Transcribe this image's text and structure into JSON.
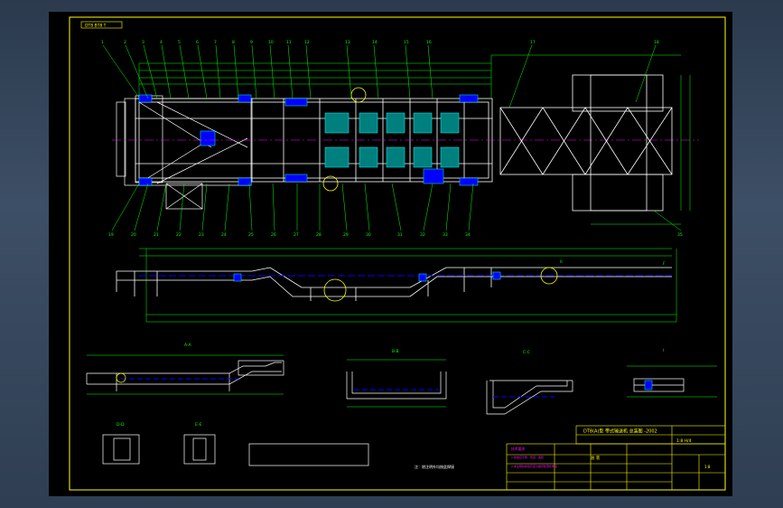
{
  "drawing": {
    "corner_tag": "DT8 BT8 T",
    "title_block": {
      "title": "DT8(A)型 带式输送机 总装图 -2002",
      "drawing_no": "1:8 H/4",
      "stamp": "总 装",
      "scale": "1:8"
    },
    "notes": {
      "tech_req_title": "技术要求",
      "line1": "1.焊缝应平整、牢固、美观",
      "line2": "2.未注明的焊缝高度为相邻较薄件厚度",
      "bottom_note": "注：除注明外均按此焊接"
    },
    "callouts": [
      "1",
      "2",
      "3",
      "4",
      "5",
      "6",
      "7",
      "8",
      "9",
      "10",
      "11",
      "12",
      "13",
      "14",
      "15",
      "16",
      "17",
      "18",
      "19",
      "20",
      "21",
      "22",
      "23",
      "24",
      "25",
      "26",
      "27",
      "28",
      "29",
      "30",
      "31",
      "32",
      "33",
      "34",
      "35",
      "36",
      "37",
      "38",
      "39",
      "40",
      "41",
      "42",
      "43",
      "44",
      "45",
      "46",
      "47",
      "48",
      "49",
      "50",
      "51",
      "52",
      "53",
      "54",
      "55",
      "56"
    ],
    "section_labels": {
      "s1": "A-A",
      "s2": "B-B",
      "s3": "C-C",
      "s4": "D-D",
      "s5": "E-E",
      "s6": "F",
      "s7": "II",
      "s8": "I"
    }
  },
  "colors": {
    "background": "#000000",
    "frame": "#ffff00",
    "geometry": "#ffffff",
    "dimension": "#00ff00",
    "center": "#ff00ff",
    "fill": "#0000ff",
    "hidden": "#00ffff"
  }
}
